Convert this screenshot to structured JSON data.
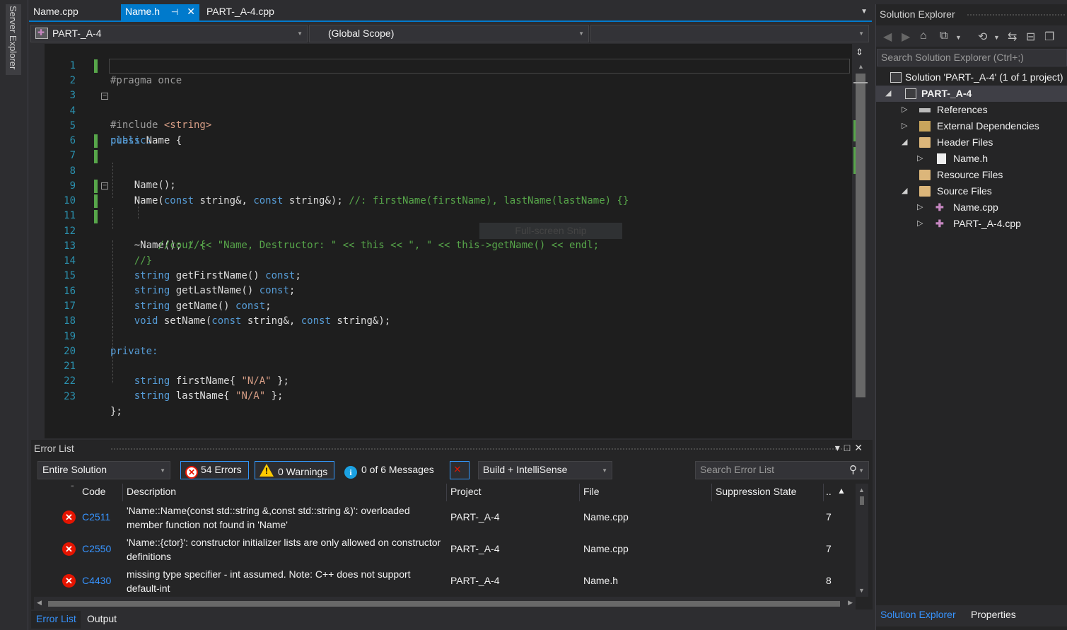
{
  "server_explorer": "Server Explorer",
  "tabs": [
    {
      "label": "Name.cpp"
    },
    {
      "label": "Name.h",
      "pin": "⊣",
      "close": "✕"
    },
    {
      "label": "PART-_A-4.cpp"
    }
  ],
  "nav": {
    "project": "PART-_A-4",
    "scope": "(Global Scope)",
    "member": ""
  },
  "code_lines": [
    {
      "n": "1"
    },
    {
      "n": "2"
    },
    {
      "n": "3"
    },
    {
      "n": "4"
    },
    {
      "n": "5"
    },
    {
      "n": "6"
    },
    {
      "n": "7"
    },
    {
      "n": "8"
    },
    {
      "n": "9"
    },
    {
      "n": "10"
    },
    {
      "n": "11"
    },
    {
      "n": "12"
    },
    {
      "n": "13"
    },
    {
      "n": "14"
    },
    {
      "n": "15"
    },
    {
      "n": "16"
    },
    {
      "n": "17"
    },
    {
      "n": "18"
    },
    {
      "n": "19"
    },
    {
      "n": "20"
    },
    {
      "n": "21"
    },
    {
      "n": "22"
    },
    {
      "n": "23"
    }
  ],
  "code": {
    "l1": "#pragma once",
    "l2a": "#include ",
    "l2b": "<string>",
    "l4a": "class ",
    "l4b": "Name {",
    "l5": "public:",
    "l7": "    Name();",
    "l8a": "    Name(",
    "l8b": "const",
    "l8c": " string&, ",
    "l8d": "const",
    "l8e": " string&); ",
    "l8f": "//: firstName(firstName), lastName(lastName) {}",
    "l10a": "    ~Name(); ",
    "l10b": "//{",
    "l11": "        //cout << \"Name, Destructor: \" << this << \", \" << this->getName() << endl;",
    "l12": "    //}",
    "l14a": "    string ",
    "l14b": "getFirstName() ",
    "l14c": "const",
    "l14d": ";",
    "l15a": "    string ",
    "l15b": "getLastName() ",
    "l15c": "const",
    "l15d": ";",
    "l16a": "    string ",
    "l16b": "getName() ",
    "l16c": "const",
    "l16d": ";",
    "l17a": "    void ",
    "l17b": "setName(",
    "l17c": "const",
    "l17d": " string&, ",
    "l17e": "const",
    "l17f": " string&);",
    "l19": "private:",
    "l21a": "    string ",
    "l21b": "firstName{ ",
    "l21c": "\"N/A\"",
    "l21d": " };",
    "l22a": "    string ",
    "l22b": "lastName{ ",
    "l22c": "\"N/A\"",
    "l22d": " };",
    "l23": "};"
  },
  "snip_overlay": "Full-screen Snip",
  "error_list": {
    "title": "Error List",
    "scope": "Entire Solution",
    "errors": "54 Errors",
    "warnings": "0 Warnings",
    "messages": "0 of 6 Messages",
    "source": "Build + IntelliSense",
    "search_placeholder": "Search Error List",
    "columns": {
      "code": "Code",
      "description": "Description",
      "project": "Project",
      "file": "File",
      "suppression": "Suppression State",
      "line": ".."
    },
    "rows": [
      {
        "code": "C2511",
        "description": "'Name::Name(const std::string &,const std::string &)': overloaded member function not found in 'Name'",
        "project": "PART-_A-4",
        "file": "Name.cpp",
        "line": "7"
      },
      {
        "code": "C2550",
        "description": "'Name::{ctor}': constructor initializer lists are only allowed on constructor definitions",
        "project": "PART-_A-4",
        "file": "Name.cpp",
        "line": "7"
      },
      {
        "code": "C4430",
        "description": "missing type specifier - int assumed. Note: C++ does not support default-int",
        "project": "PART-_A-4",
        "file": "Name.h",
        "line": "8"
      }
    ]
  },
  "bottom_tabs": [
    "Error List",
    "Output"
  ],
  "solution_explorer": {
    "title": "Solution Explorer",
    "search_placeholder": "Search Solution Explorer (Ctrl+;)",
    "tree": [
      {
        "label": "Solution 'PART-_A-4' (1 of 1 project)"
      },
      {
        "label": "PART-_A-4"
      },
      {
        "label": "References"
      },
      {
        "label": "External Dependencies"
      },
      {
        "label": "Header Files"
      },
      {
        "label": "Name.h"
      },
      {
        "label": "Resource Files"
      },
      {
        "label": "Source Files"
      },
      {
        "label": "Name.cpp"
      },
      {
        "label": "PART-_A-4.cpp"
      }
    ],
    "bottom_tabs": [
      "Solution Explorer",
      "Properties"
    ]
  },
  "colors": {
    "accent": "#007acc",
    "keyword": "#569cd6",
    "comment": "#57a64a",
    "string": "#d69d85",
    "line_number": "#2b91af",
    "error": "#e51400"
  }
}
